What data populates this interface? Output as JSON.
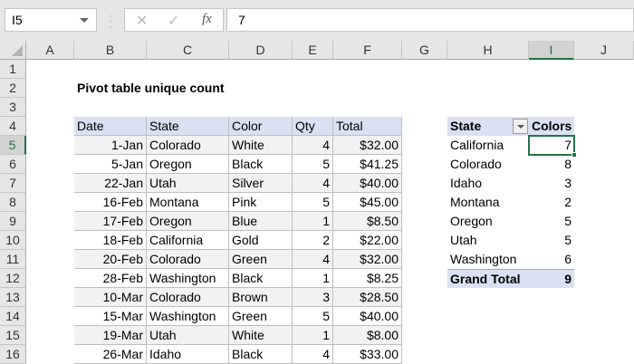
{
  "formula_bar": {
    "name_box": "I5",
    "cancel_icon": "✕",
    "enter_icon": "✓",
    "fx_label": "fx",
    "value": "7"
  },
  "columns": [
    "A",
    "B",
    "C",
    "D",
    "E",
    "F",
    "G",
    "H",
    "I",
    "J"
  ],
  "selected_column": "I",
  "rows": [
    "1",
    "2",
    "3",
    "4",
    "5",
    "6",
    "7",
    "8",
    "9",
    "10",
    "11",
    "12",
    "13",
    "14",
    "15",
    "16"
  ],
  "selected_row": "5",
  "title": "Pivot table unique count",
  "table": {
    "headers": [
      "Date",
      "State",
      "Color",
      "Qty",
      "Total"
    ],
    "rows": [
      [
        "1-Jan",
        "Colorado",
        "White",
        "4",
        "$32.00"
      ],
      [
        "5-Jan",
        "Oregon",
        "Black",
        "5",
        "$41.25"
      ],
      [
        "22-Jan",
        "Utah",
        "Silver",
        "4",
        "$40.00"
      ],
      [
        "16-Feb",
        "Montana",
        "Pink",
        "5",
        "$45.00"
      ],
      [
        "17-Feb",
        "Oregon",
        "Blue",
        "1",
        "$8.50"
      ],
      [
        "18-Feb",
        "California",
        "Gold",
        "2",
        "$22.00"
      ],
      [
        "20-Feb",
        "Colorado",
        "Green",
        "4",
        "$32.00"
      ],
      [
        "28-Feb",
        "Washington",
        "Black",
        "1",
        "$8.25"
      ],
      [
        "10-Mar",
        "Colorado",
        "Brown",
        "3",
        "$28.50"
      ],
      [
        "15-Mar",
        "Washington",
        "Green",
        "5",
        "$40.00"
      ],
      [
        "19-Mar",
        "Utah",
        "White",
        "1",
        "$8.00"
      ],
      [
        "26-Mar",
        "Idaho",
        "Black",
        "4",
        "$33.00"
      ]
    ]
  },
  "pivot": {
    "headers": [
      "State",
      "Colors"
    ],
    "rows": [
      [
        "California",
        "7"
      ],
      [
        "Colorado",
        "8"
      ],
      [
        "Idaho",
        "3"
      ],
      [
        "Montana",
        "2"
      ],
      [
        "Oregon",
        "5"
      ],
      [
        "Utah",
        "5"
      ],
      [
        "Washington",
        "6"
      ]
    ],
    "grand_total": [
      "Grand Total",
      "9"
    ]
  },
  "colors": {
    "accent": "#217346",
    "header_fill": "#d9e1f2",
    "alt_row": "#f2f2f2"
  }
}
